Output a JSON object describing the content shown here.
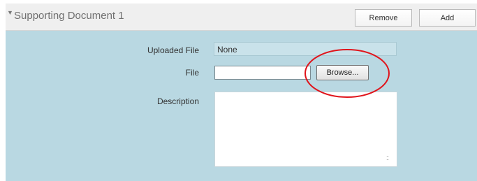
{
  "section": {
    "title": "Supporting Document 1",
    "remove_label": "Remove",
    "add_label": "Add"
  },
  "form": {
    "uploaded_file_label": "Uploaded File",
    "uploaded_file_value": "None",
    "file_label": "File",
    "file_value": "",
    "browse_label": "Browse...",
    "description_label": "Description",
    "description_value": ""
  },
  "annotation": {
    "highlight_color": "#e0141b"
  },
  "colors": {
    "header_bg": "#efefef",
    "body_bg": "#b9d8e2"
  }
}
